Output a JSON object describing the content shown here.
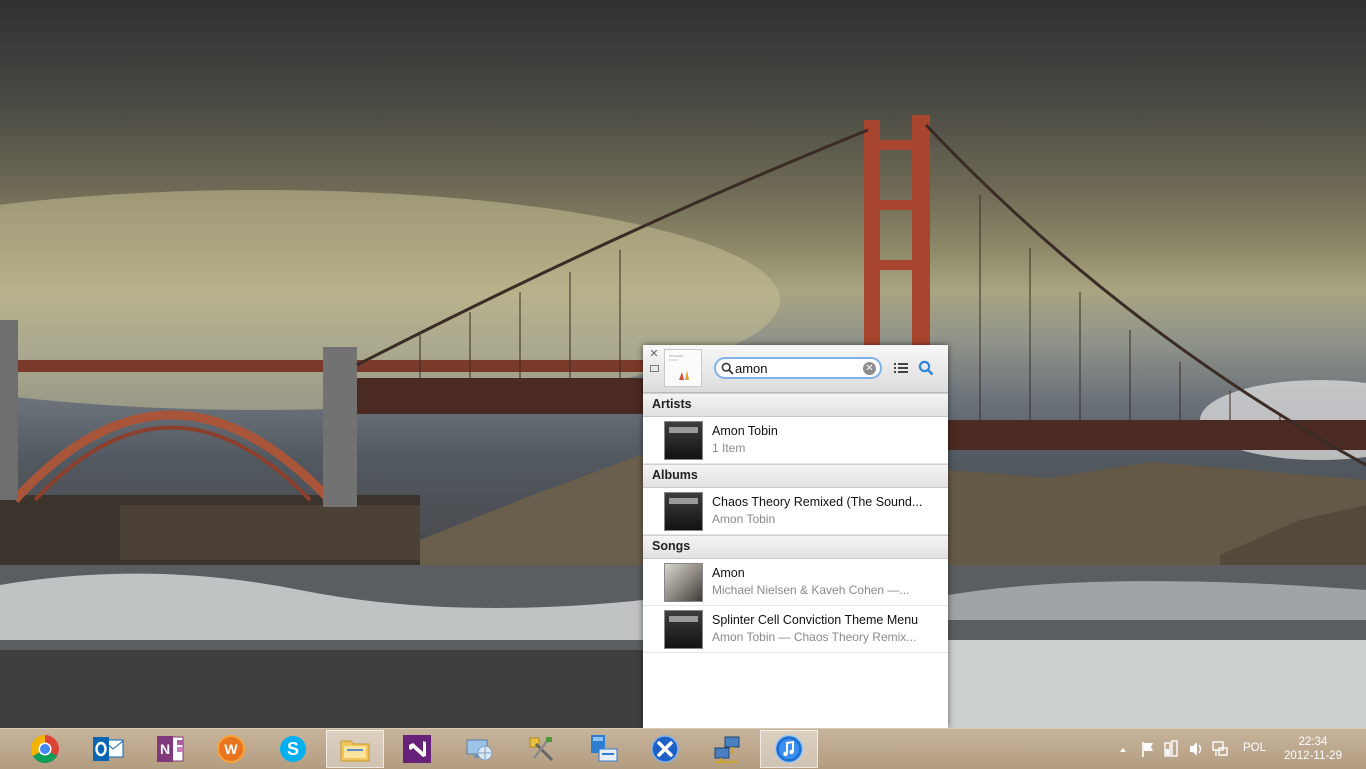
{
  "player": {
    "search": {
      "value": "amon"
    },
    "sections": {
      "artists": {
        "header": "Artists",
        "items": [
          {
            "title": "Amon Tobin",
            "subtitle": "1 Item"
          }
        ]
      },
      "albums": {
        "header": "Albums",
        "items": [
          {
            "title": "Chaos Theory Remixed (The Sound...",
            "subtitle": "Amon Tobin"
          }
        ]
      },
      "songs": {
        "header": "Songs",
        "items": [
          {
            "title": "Amon",
            "subtitle": "Michael Nielsen & Kaveh Cohen —..."
          },
          {
            "title": "Splinter Cell Conviction Theme Menu",
            "subtitle": "Amon Tobin — Chaos Theory Remix..."
          }
        ]
      }
    }
  },
  "taskbar": {
    "apps": [
      {
        "name": "chrome-icon",
        "active": false
      },
      {
        "name": "outlook-icon",
        "active": false
      },
      {
        "name": "onenote-icon",
        "active": false
      },
      {
        "name": "wps-office-icon",
        "active": false
      },
      {
        "name": "skype-icon",
        "active": false
      },
      {
        "name": "file-explorer-icon",
        "active": true
      },
      {
        "name": "visual-studio-icon",
        "active": false
      },
      {
        "name": "remote-desktop-icon",
        "active": false
      },
      {
        "name": "tools-icon",
        "active": false
      },
      {
        "name": "network-share-icon",
        "active": false
      },
      {
        "name": "xmarks-icon",
        "active": false
      },
      {
        "name": "network-connect-icon",
        "active": false
      },
      {
        "name": "itunes-icon",
        "active": true
      }
    ],
    "tray": {
      "language": "POL",
      "time": "22:34",
      "date": "2012-11-29"
    }
  },
  "colors": {
    "accent": "#3a8ee6",
    "search_focus": "#7fb2e6",
    "bridge": "#a8452e",
    "taskbar": "#bda78c"
  }
}
